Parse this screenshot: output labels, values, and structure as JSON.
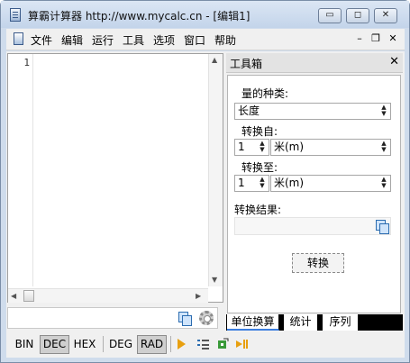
{
  "window": {
    "title": "算霸计算器 http://www.mycalc.cn - [编辑1]",
    "controls": {
      "minimize": "▭",
      "maximize": "◻",
      "close": "✕"
    }
  },
  "menubar": {
    "items": [
      "文件",
      "编辑",
      "运行",
      "工具",
      "选项",
      "窗口",
      "帮助"
    ],
    "mdi_controls": {
      "minimize": "–",
      "restore": "❐",
      "close": "✕"
    }
  },
  "editor": {
    "line_numbers": [
      "1"
    ]
  },
  "toolbox": {
    "title": "工具箱",
    "close": "✕",
    "kind_label": "量的种类:",
    "kind_value": "长度",
    "from_label": "转换自:",
    "from_amount": "1",
    "from_unit": "米(m)",
    "to_label": "转换至:",
    "to_amount": "1",
    "to_unit": "米(m)",
    "result_label": "转换结果:",
    "convert_button": "转换",
    "tabs": [
      "单位换算",
      "统计",
      "序列"
    ]
  },
  "statusbar": {
    "modes": [
      "BIN",
      "DEC",
      "HEX",
      "DEG",
      "RAD"
    ],
    "active_modes": [
      "DEC",
      "RAD"
    ]
  },
  "colors": {
    "title_bar": "#c3d4ea",
    "active_tab_underline": "#3b7ee0",
    "run_arrow": "#e8a010"
  }
}
